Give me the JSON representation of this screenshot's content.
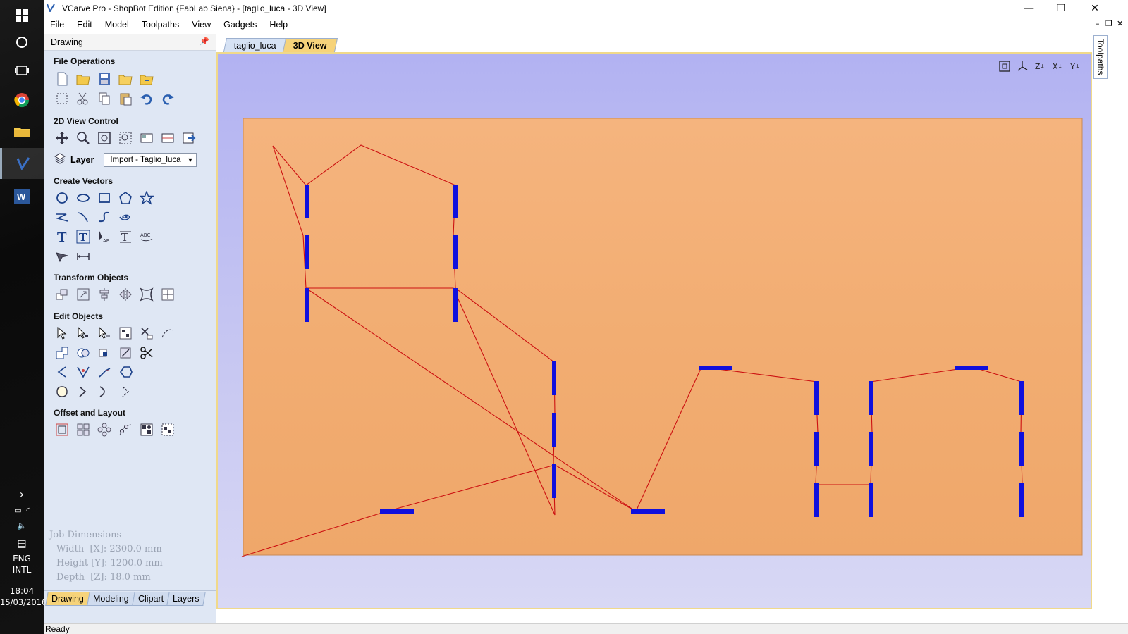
{
  "window": {
    "title": "VCarve Pro - ShopBot Edition {FabLab Siena} - [taglio_luca - 3D View]"
  },
  "menu": [
    "File",
    "Edit",
    "Model",
    "Toolpaths",
    "View",
    "Gadgets",
    "Help"
  ],
  "panel": {
    "header": "Drawing",
    "sections": {
      "file_operations": "File Operations",
      "view_control": "2D View Control",
      "create_vectors": "Create Vectors",
      "transform_objects": "Transform Objects",
      "edit_objects": "Edit Objects",
      "offset_layout": "Offset and Layout"
    },
    "layer": {
      "label": "Layer",
      "selected": "Import - Taglio_luca"
    },
    "job_dimensions": {
      "title": "Job Dimensions",
      "width": "Width  [X]: 2300.0 mm",
      "height": "Height [Y]: 1200.0 mm",
      "depth": "Depth  [Z]: 18.0 mm"
    },
    "tabs": [
      "Drawing",
      "Modeling",
      "Clipart",
      "Layers"
    ],
    "active_tab": "Drawing"
  },
  "document": {
    "tabs": [
      "taglio_luca",
      "3D View"
    ],
    "active_tab": "3D View",
    "view_controls": [
      "zoom-fit-icon",
      "view-iso-icon",
      "view-z-icon",
      "view-x-icon",
      "view-y-icon"
    ],
    "view_labels": [
      "Z",
      "X",
      "Y"
    ]
  },
  "right_tab": "Toolpaths",
  "status": "Ready",
  "taskbar": {
    "lang": "ENG",
    "layout": "INTL",
    "time": "18:04",
    "date": "15/03/2016"
  },
  "colors": {
    "board": "#f3b27a",
    "vector": "#cc1111",
    "tab": "#1010dd",
    "panel_bg": "#dfe7f4",
    "active_tab": "#f6d37a"
  }
}
